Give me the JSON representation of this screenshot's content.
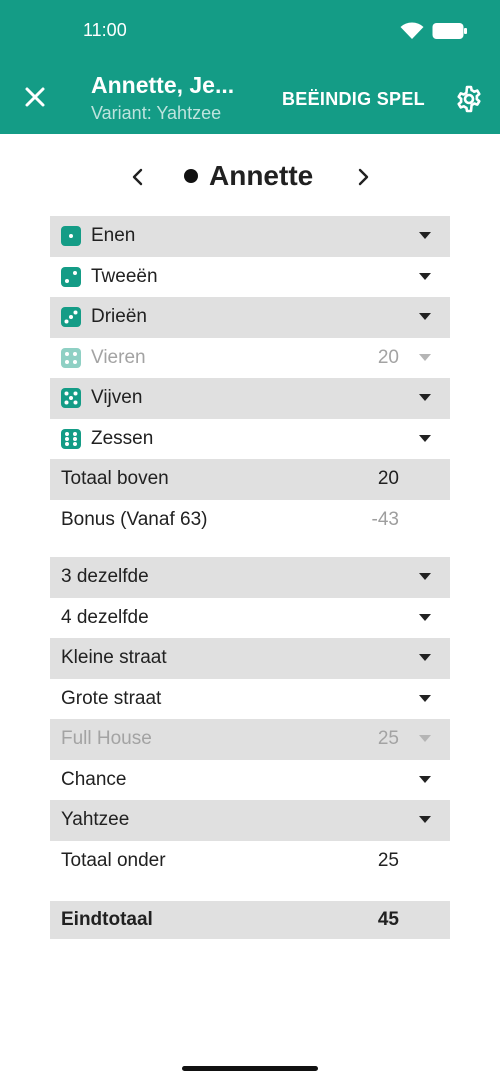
{
  "status_bar": {
    "time": "11:00",
    "wifi_icon": "wifi-icon",
    "battery_icon": "battery-icon"
  },
  "header": {
    "close_icon": "close-icon",
    "title": "Annette, Je...",
    "subtitle": "Variant: Yahtzee",
    "end_game_label": "BEËINDIG SPEL",
    "settings_icon": "gear-icon",
    "color": "#149C86"
  },
  "player_nav": {
    "prev_icon": "chevron-left-icon",
    "next_icon": "chevron-right-icon",
    "player_name": "Annette"
  },
  "upper": {
    "rows": [
      {
        "label": "Enen",
        "value": "",
        "icon": "dice-one-icon"
      },
      {
        "label": "Tweeën",
        "value": "",
        "icon": "dice-two-icon"
      },
      {
        "label": "Drieën",
        "value": "",
        "icon": "dice-three-icon"
      },
      {
        "label": "Vieren",
        "value": "20",
        "icon": "dice-four-icon"
      },
      {
        "label": "Vijven",
        "value": "",
        "icon": "dice-five-icon"
      },
      {
        "label": "Zessen",
        "value": "",
        "icon": "dice-six-icon"
      }
    ],
    "total_label": "Totaal boven",
    "total_value": "20",
    "bonus_label": "Bonus (Vanaf 63)",
    "bonus_value": "-43"
  },
  "lower": {
    "rows": [
      {
        "label": "3 dezelfde",
        "value": ""
      },
      {
        "label": "4 dezelfde",
        "value": ""
      },
      {
        "label": "Kleine straat",
        "value": ""
      },
      {
        "label": "Grote straat",
        "value": ""
      },
      {
        "label": "Full House",
        "value": "25"
      },
      {
        "label": "Chance",
        "value": ""
      },
      {
        "label": "Yahtzee",
        "value": ""
      }
    ],
    "total_label": "Totaal onder",
    "total_value": "25"
  },
  "grand_total": {
    "label": "Eindtotaal",
    "value": "45"
  },
  "colors": {
    "accent": "#149C86",
    "row_shade": "#e0e0e0",
    "muted": "#9e9e9e"
  }
}
